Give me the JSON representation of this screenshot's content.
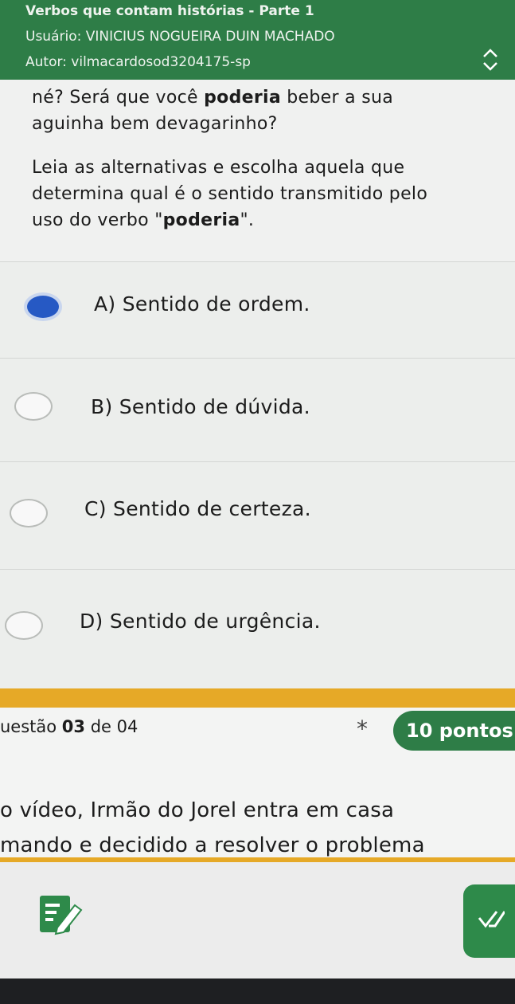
{
  "header": {
    "title": "Verbos que contam histórias - Parte 1",
    "user": "Usuário: VINICIUS NOGUEIRA DUIN MACHADO",
    "author": "Autor: vilmacardosod3204175-sp",
    "collapse_icon": "chevron-up-down-icon"
  },
  "question2": {
    "text_line1": "né? Será que você ",
    "text_bold": "poderia",
    "text_line1_end": " beber a sua",
    "text_line2": "aguinha bem devagarinho?",
    "prompt_line1": "Leia as alternativas e escolha aquela que",
    "prompt_line2": "determina qual é o sentido transmitido pelo",
    "prompt_line3_start": "uso do verbo \"",
    "prompt_line3_bold": "poderia",
    "prompt_line3_end": "\".",
    "options": [
      {
        "label": "A) Sentido de ordem.",
        "selected": true
      },
      {
        "label": "B) Sentido de dúvida.",
        "selected": false
      },
      {
        "label": "C) Sentido de certeza.",
        "selected": false
      },
      {
        "label": "D) Sentido de urgência.",
        "selected": false
      }
    ]
  },
  "question3": {
    "number_prefix": "uestão ",
    "number": "03",
    "number_suffix": " de 04",
    "required_mark": "*",
    "points": "10 pontos",
    "text_line1": "o vídeo, Irmão do Jorel entra em casa",
    "text_line2": "mando e decidido a resolver o problema"
  },
  "bottom": {
    "edit_icon": "edit-note-icon",
    "confirm_icon": "double-check-icon"
  },
  "colors": {
    "header_green": "#2e7d47",
    "accent_yellow": "#e6a927",
    "selected_blue": "#2659c4"
  }
}
